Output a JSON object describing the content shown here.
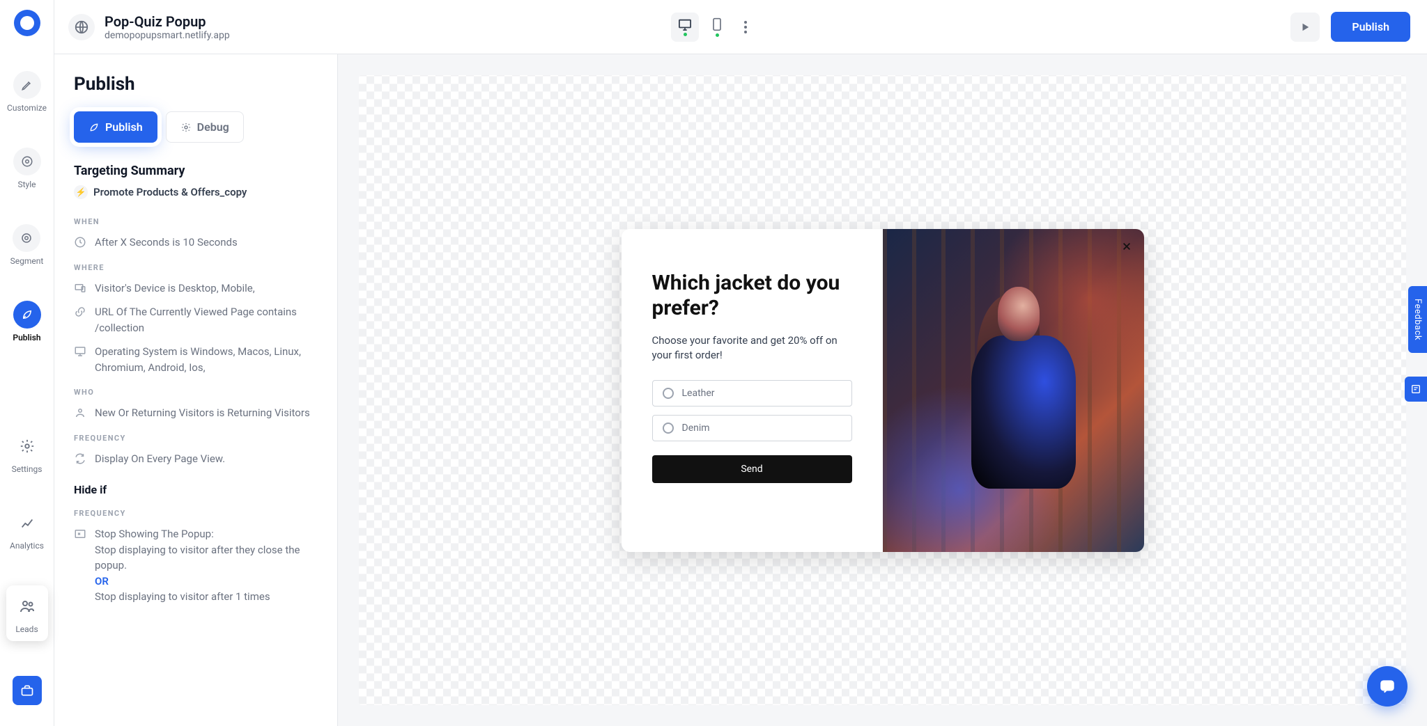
{
  "header": {
    "title": "Pop-Quiz Popup",
    "subtitle": "demopopupsmart.netlify.app",
    "publish_label": "Publish"
  },
  "left_rail": {
    "items": [
      {
        "id": "customize",
        "label": "Customize"
      },
      {
        "id": "style",
        "label": "Style"
      },
      {
        "id": "segment",
        "label": "Segment"
      },
      {
        "id": "publish",
        "label": "Publish"
      }
    ],
    "bottom": [
      {
        "id": "settings",
        "label": "Settings"
      },
      {
        "id": "analytics",
        "label": "Analytics"
      },
      {
        "id": "leads",
        "label": "Leads"
      }
    ]
  },
  "panel": {
    "title": "Publish",
    "tabs": {
      "publish": "Publish",
      "debug": "Debug"
    },
    "section_heading": "Targeting Summary",
    "promote": "Promote Products & Offers_copy",
    "when_heading": "WHEN",
    "when_rule": "After X Seconds is 10 Seconds",
    "where_heading": "WHERE",
    "where_rules": {
      "device": "Visitor's Device is Desktop, Mobile,",
      "url": "URL Of The Currently Viewed Page contains /collection",
      "os": "Operating System is Windows, Macos, Linux, Chromium, Android, Ios,"
    },
    "who_heading": "WHO",
    "who_rule": "New Or Returning Visitors is Returning Visitors",
    "frequency_heading": "FREQUENCY",
    "frequency_rule": "Display On Every Page View.",
    "hideif_heading": "Hide if",
    "hideif_sub": "FREQUENCY",
    "hideif_rule_title": "Stop Showing The Popup:",
    "hideif_rule_line1": "Stop displaying to visitor after they close the popup.",
    "hideif_rule_or": "OR",
    "hideif_rule_line2": "Stop displaying to visitor after 1 times"
  },
  "popup": {
    "title": "Which jacket do you prefer?",
    "desc": "Choose your favorite and get 20% off on your first order!",
    "options": [
      "Leather",
      "Denim"
    ],
    "send": "Send"
  },
  "feedback": {
    "label": "Feedback"
  }
}
